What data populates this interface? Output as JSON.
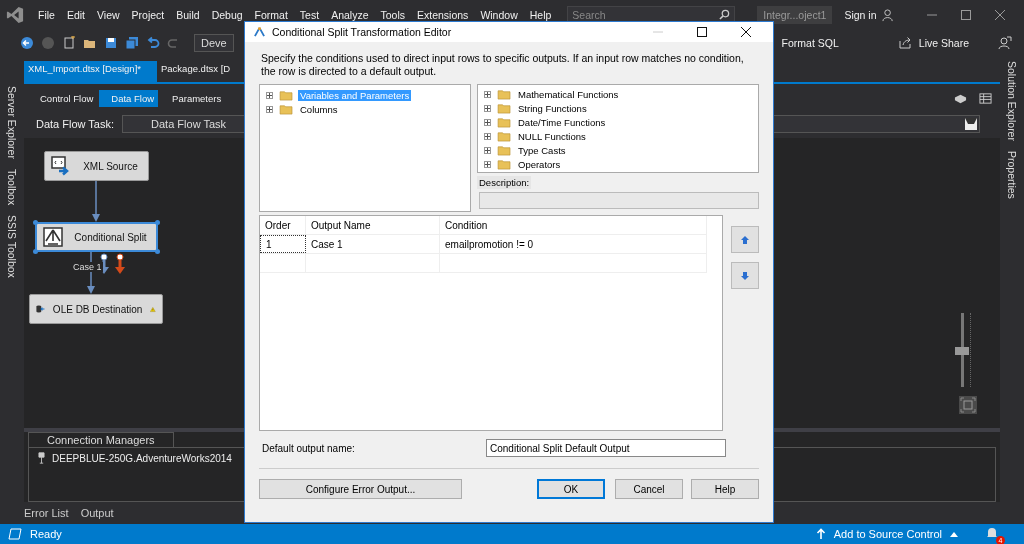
{
  "ide": {
    "menu": [
      "File",
      "Edit",
      "View",
      "Project",
      "Build",
      "Debug",
      "Format",
      "Test",
      "Analyze",
      "Tools",
      "Extensions",
      "Window",
      "Help"
    ],
    "search": {
      "placeholder": "Search"
    },
    "solution_name": "Integr...oject1",
    "sign_in": "Sign in",
    "toolbar": {
      "configuration": "Deve",
      "format_sql": "Format SQL",
      "live_share": "Live Share"
    },
    "document_tabs": [
      {
        "label": "XML_Import.dtsx [Design]*",
        "selected": true
      },
      {
        "label": "Package.dtsx [D",
        "selected": false
      }
    ],
    "designer_tabs": [
      {
        "label": "Control Flow",
        "selected": false
      },
      {
        "label": "Data Flow",
        "selected": true
      },
      {
        "label": "Parameters",
        "selected": false
      }
    ],
    "task_label": "Data Flow Task:",
    "task_value": "Data Flow Task",
    "left_tool_tabs": [
      "Server Explorer",
      "Toolbox",
      "SSIS Toolbox"
    ],
    "right_tool_tabs": [
      "Solution Explorer",
      "Properties"
    ],
    "canvas": {
      "nodes": [
        {
          "label": "XML Source",
          "kind": "source",
          "selected": false,
          "warning": false
        },
        {
          "label": "Conditional Split",
          "kind": "split",
          "selected": true,
          "warning": false
        },
        {
          "label": "OLE DB Destination",
          "kind": "destination",
          "selected": false,
          "warning": true
        }
      ],
      "path_label": "Case 1"
    },
    "zoom_slider": {
      "level": 0.5
    },
    "connection_managers": {
      "title": "Connection Managers",
      "items": [
        "DEEPBLUE-250G.AdventureWorks2014"
      ]
    },
    "bottom_tabs": [
      "Error List",
      "Output"
    ],
    "status_bar": {
      "text": "Ready",
      "source_control": "Add to Source Control",
      "notifications": "4"
    }
  },
  "dialog": {
    "title": "Conditional Split Transformation Editor",
    "description": "Specify the conditions used to direct input rows to specific outputs. If an input row matches no condition, the row is directed to a default output.",
    "variables_tree": [
      {
        "label": "Variables and Parameters",
        "selected": true
      },
      {
        "label": "Columns",
        "selected": false
      }
    ],
    "functions_tree": [
      "Mathematical Functions",
      "String Functions",
      "Date/Time Functions",
      "NULL Functions",
      "Type Casts",
      "Operators"
    ],
    "description_label": "Description:",
    "grid": {
      "columns": [
        "Order",
        "Output Name",
        "Condition"
      ],
      "rows": [
        [
          "1",
          "Case 1",
          "emailpromotion != 0"
        ]
      ]
    },
    "default_output_label": "Default output name:",
    "default_output_value": "Conditional Split Default Output",
    "error_output_button": "Configure Error Output...",
    "buttons": [
      {
        "label": "OK",
        "default": true
      },
      {
        "label": "Cancel",
        "default": false
      },
      {
        "label": "Help",
        "default": false
      }
    ]
  }
}
